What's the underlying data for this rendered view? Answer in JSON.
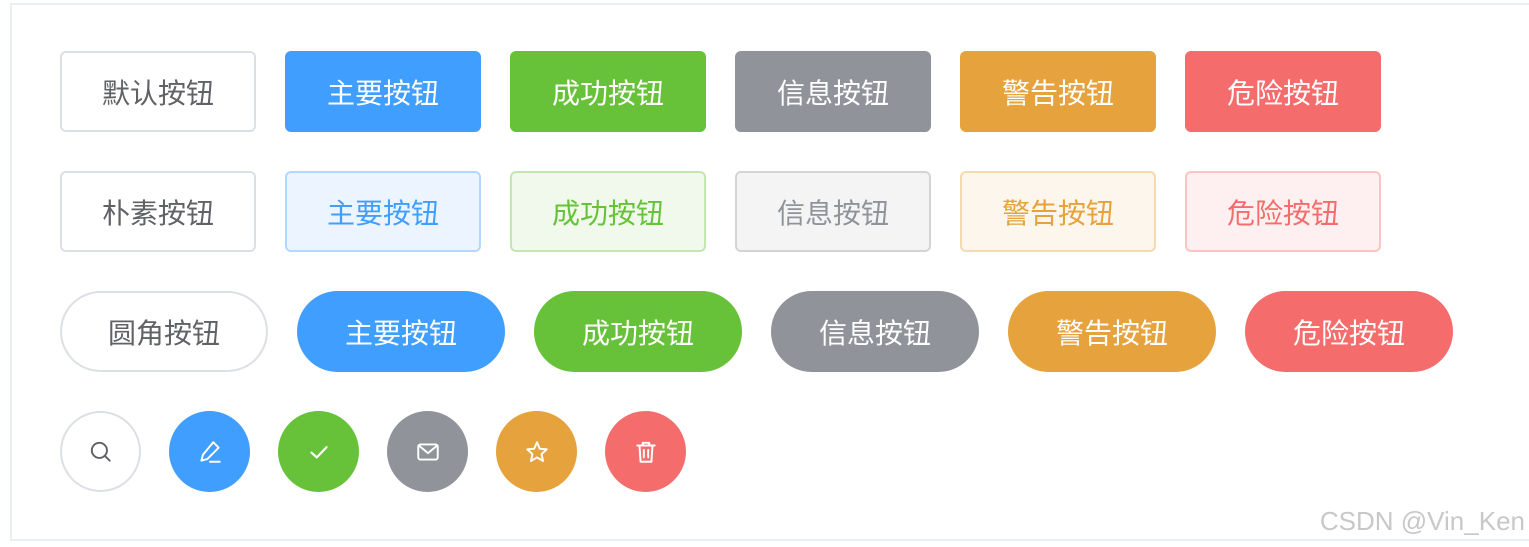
{
  "rows": {
    "default": [
      {
        "label": "默认按钮",
        "type": "default"
      },
      {
        "label": "主要按钮",
        "type": "primary"
      },
      {
        "label": "成功按钮",
        "type": "success"
      },
      {
        "label": "信息按钮",
        "type": "info"
      },
      {
        "label": "警告按钮",
        "type": "warning"
      },
      {
        "label": "危险按钮",
        "type": "danger"
      }
    ],
    "plain": [
      {
        "label": "朴素按钮",
        "type": "default"
      },
      {
        "label": "主要按钮",
        "type": "primary"
      },
      {
        "label": "成功按钮",
        "type": "success"
      },
      {
        "label": "信息按钮",
        "type": "info"
      },
      {
        "label": "警告按钮",
        "type": "warning"
      },
      {
        "label": "危险按钮",
        "type": "danger"
      }
    ],
    "round": [
      {
        "label": "圆角按钮",
        "type": "default"
      },
      {
        "label": "主要按钮",
        "type": "primary"
      },
      {
        "label": "成功按钮",
        "type": "success"
      },
      {
        "label": "信息按钮",
        "type": "info"
      },
      {
        "label": "警告按钮",
        "type": "warning"
      },
      {
        "label": "危险按钮",
        "type": "danger"
      }
    ],
    "circle": [
      {
        "icon": "search-icon",
        "type": "default"
      },
      {
        "icon": "edit-icon",
        "type": "primary"
      },
      {
        "icon": "check-icon",
        "type": "success"
      },
      {
        "icon": "message-icon",
        "type": "info"
      },
      {
        "icon": "star-icon",
        "type": "warning"
      },
      {
        "icon": "delete-icon",
        "type": "danger"
      }
    ]
  },
  "colors": {
    "default_border": "#dcdfe6",
    "default_text": "#606266",
    "primary": "#409eff",
    "success": "#67c23a",
    "info": "#909399",
    "warning": "#e6a23c",
    "danger": "#f56c6c"
  },
  "watermark": "CSDN @Vin_Ken"
}
